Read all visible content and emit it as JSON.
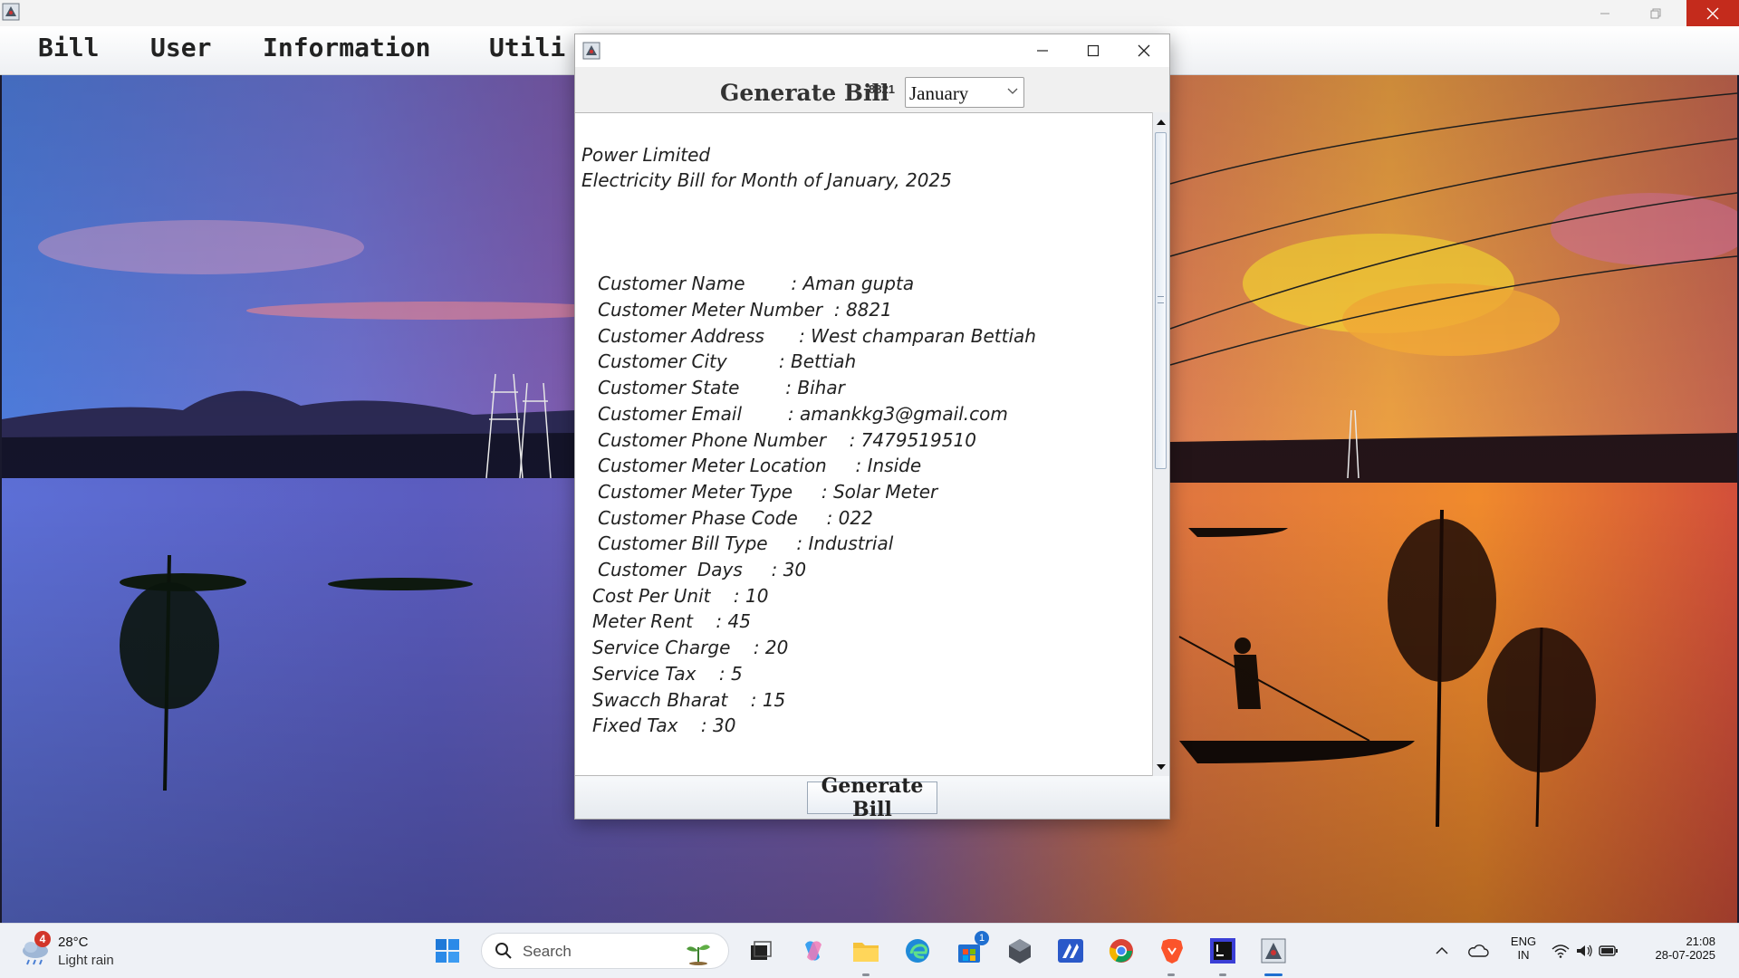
{
  "menu": {
    "items": [
      "Bill",
      "User",
      "Information",
      "Utili"
    ]
  },
  "dialog": {
    "header_title": "Generate Bill",
    "meter_number": "8821",
    "selected_month": "January",
    "bill": {
      "company": "Power Limited",
      "subtitle": "Electricity Bill for Month of January, 2025",
      "lines": [
        "Customer Name        : Aman gupta",
        "Customer Meter Number  : 8821",
        "Customer Address      : West champaran Bettiah",
        "Customer City         : Bettiah",
        "Customer State        : Bihar",
        "Customer Email        : amankkg3@gmail.com",
        "Customer Phone Number    : 7479519510",
        "Customer Meter Location     : Inside",
        "Customer Meter Type     : Solar Meter",
        "Customer Phase Code     : 022",
        "Customer Bill Type     : Industrial",
        "Customer  Days     : 30"
      ],
      "charges": [
        "Cost Per Unit    : 10",
        "Meter Rent    : 45",
        "Service Charge    : 20",
        "Service Tax    : 5",
        "Swacch Bharat    : 15",
        "Fixed Tax    : 30"
      ]
    },
    "button_label": "Generate Bill"
  },
  "taskbar": {
    "weather": {
      "temperature": "28°C",
      "condition": "Light rain",
      "badge": "4"
    },
    "search_placeholder": "Search",
    "store_badge": "1",
    "language": {
      "line1": "ENG",
      "line2": "IN"
    },
    "time": "21:08",
    "date": "28-07-2025"
  },
  "colors": {
    "close_button": "#c42b1c",
    "taskbar_bg": "#eef1f6",
    "dialog_bg": "#f4f4f4"
  }
}
